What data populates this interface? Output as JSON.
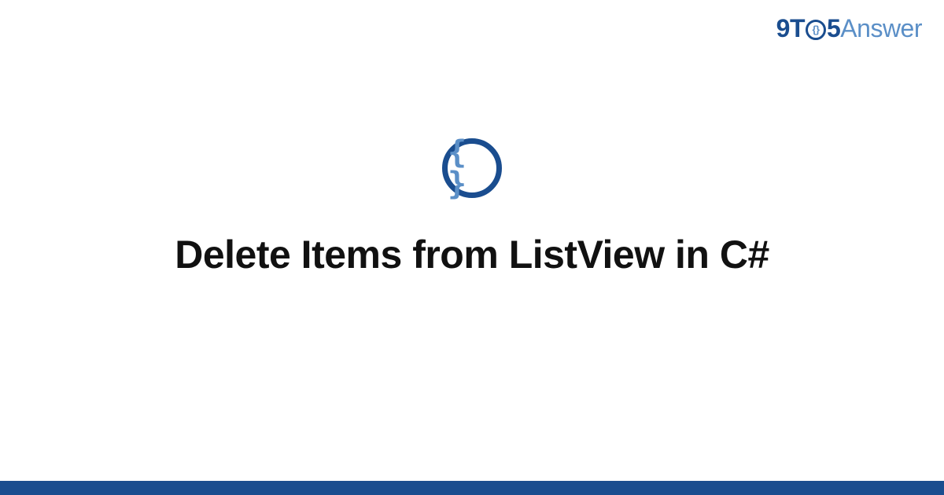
{
  "logo": {
    "part1": "9T",
    "circle_inner": "{}",
    "part2": "5",
    "part3": "Answer"
  },
  "category": {
    "icon_name": "code-braces-icon",
    "symbol": "{ }"
  },
  "page": {
    "title": "Delete Items from ListView in C#"
  },
  "colors": {
    "brand_dark": "#1a4d8f",
    "brand_light": "#5b8fc7",
    "text": "#111111",
    "background": "#ffffff"
  }
}
